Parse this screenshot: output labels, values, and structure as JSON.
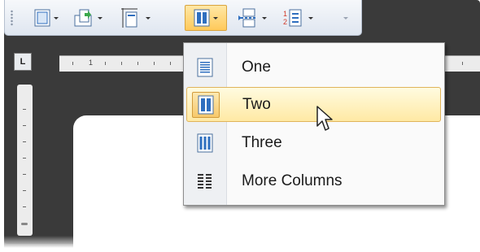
{
  "toolbar": {
    "buttons": [
      {
        "icon": "page-margins-icon",
        "has_dropdown": true
      },
      {
        "icon": "orientation-icon",
        "has_dropdown": true
      },
      {
        "icon": "page-size-icon",
        "has_dropdown": true
      },
      {
        "icon": "columns-icon",
        "has_dropdown": true,
        "active": true
      },
      {
        "icon": "breaks-icon",
        "has_dropdown": true
      },
      {
        "icon": "line-numbers-icon",
        "has_dropdown": true
      },
      {
        "icon": "toolbar-options-icon",
        "has_dropdown": true
      }
    ]
  },
  "ruler": {
    "corner_label": "L",
    "first_number": "1"
  },
  "columns_menu": {
    "items": [
      {
        "label": "One",
        "icon": "one-column-icon"
      },
      {
        "label": "Two",
        "icon": "two-columns-icon",
        "selected": true,
        "hovered": true
      },
      {
        "label": "Three",
        "icon": "three-columns-icon"
      },
      {
        "label": "More Columns",
        "icon": "more-columns-icon"
      }
    ]
  },
  "colors": {
    "accent_highlight": "#ffc95a",
    "hover_border": "#e0b45a",
    "icon_blue": "#2f6fbf"
  }
}
